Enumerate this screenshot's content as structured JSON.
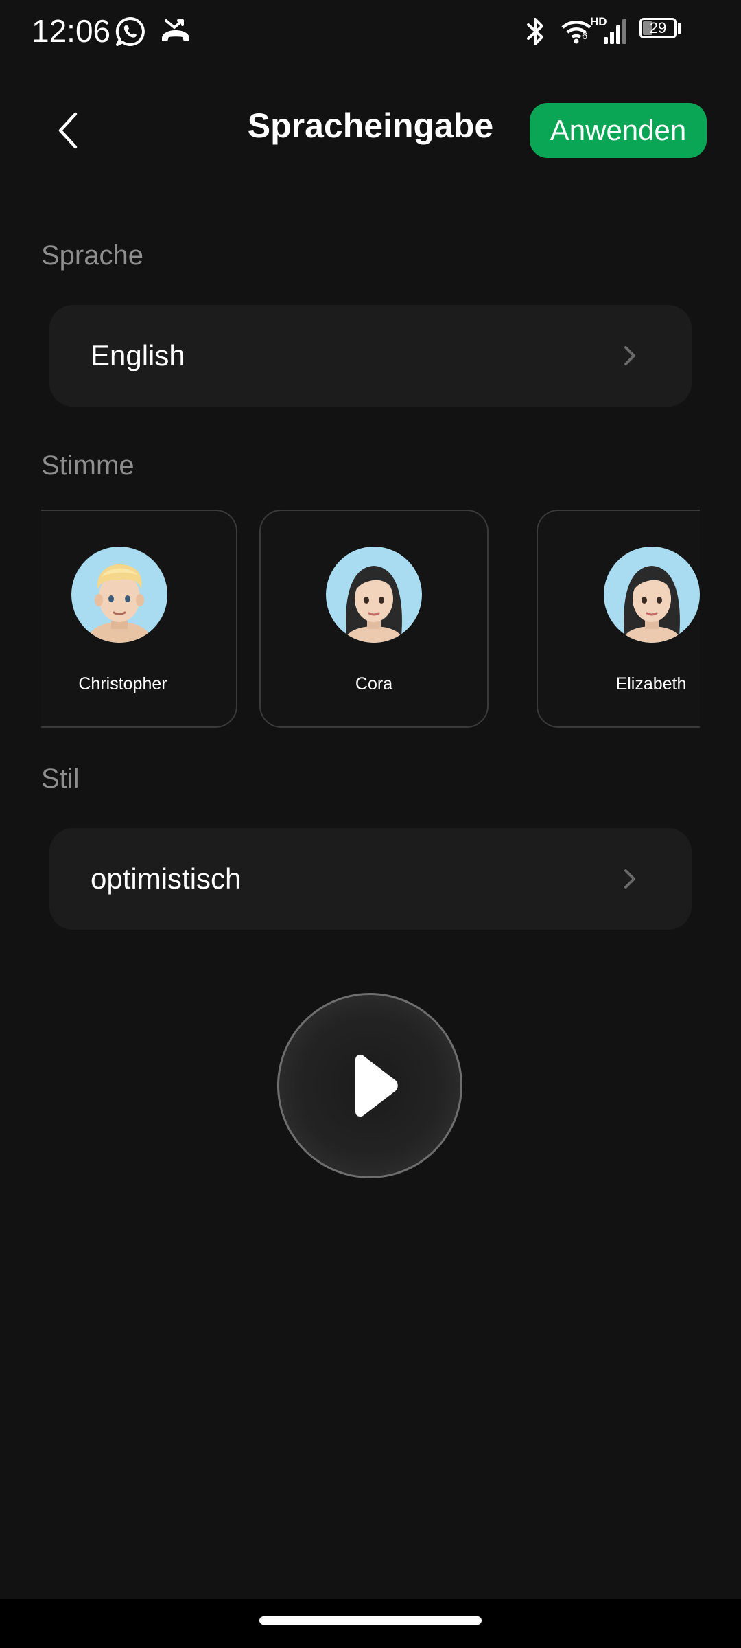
{
  "status_bar": {
    "time": "12:06",
    "battery_level": "29",
    "network_badge": "HD",
    "network_sub": "6",
    "icons": [
      "whatsapp-icon",
      "missed-call-icon",
      "bluetooth-icon",
      "wifi-icon",
      "signal-icon",
      "battery-icon"
    ]
  },
  "header": {
    "title": "Spracheingabe",
    "apply_label": "Anwenden",
    "back_icon": "chevron-left-icon",
    "accent_color": "#0aa656"
  },
  "language": {
    "label": "Sprache",
    "value": "English"
  },
  "voice": {
    "label": "Stimme",
    "options": [
      {
        "name": "Christopher",
        "avatar": "blond-man-avatar"
      },
      {
        "name": "Cora",
        "avatar": "dark-haired-woman-avatar"
      },
      {
        "name": "Elizabeth",
        "avatar": "dark-haired-woman-avatar"
      }
    ]
  },
  "style": {
    "label": "Stil",
    "value": "optimistisch"
  },
  "player": {
    "icon": "play-icon"
  }
}
